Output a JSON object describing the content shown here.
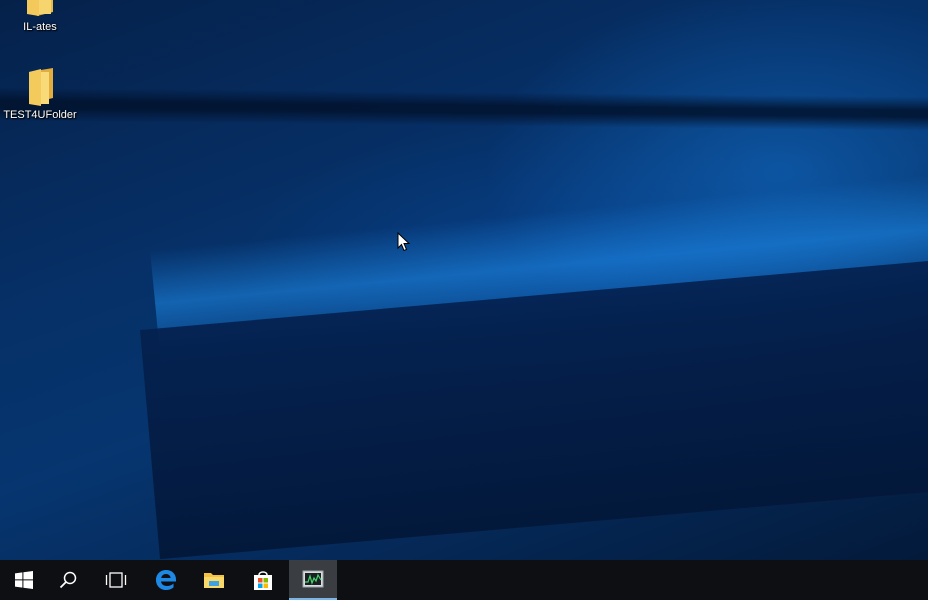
{
  "desktop": {
    "icons": [
      {
        "label": "IL-ates",
        "icon": "folder-icon"
      },
      {
        "label": "TEST4UFolder",
        "icon": "folder-icon"
      }
    ]
  },
  "taskbar": {
    "buttons": [
      {
        "name": "start",
        "icon": "windows-logo-icon"
      },
      {
        "name": "search",
        "icon": "search-icon"
      },
      {
        "name": "task-view",
        "icon": "task-view-icon"
      },
      {
        "name": "edge",
        "icon": "edge-icon"
      },
      {
        "name": "file-explorer",
        "icon": "file-explorer-icon"
      },
      {
        "name": "store",
        "icon": "store-icon"
      },
      {
        "name": "task-manager",
        "icon": "task-manager-icon",
        "active": true
      }
    ]
  },
  "colors": {
    "taskbar": "#0e0f12",
    "accent": "#7cb4e6",
    "folder": "#f3d36b"
  }
}
